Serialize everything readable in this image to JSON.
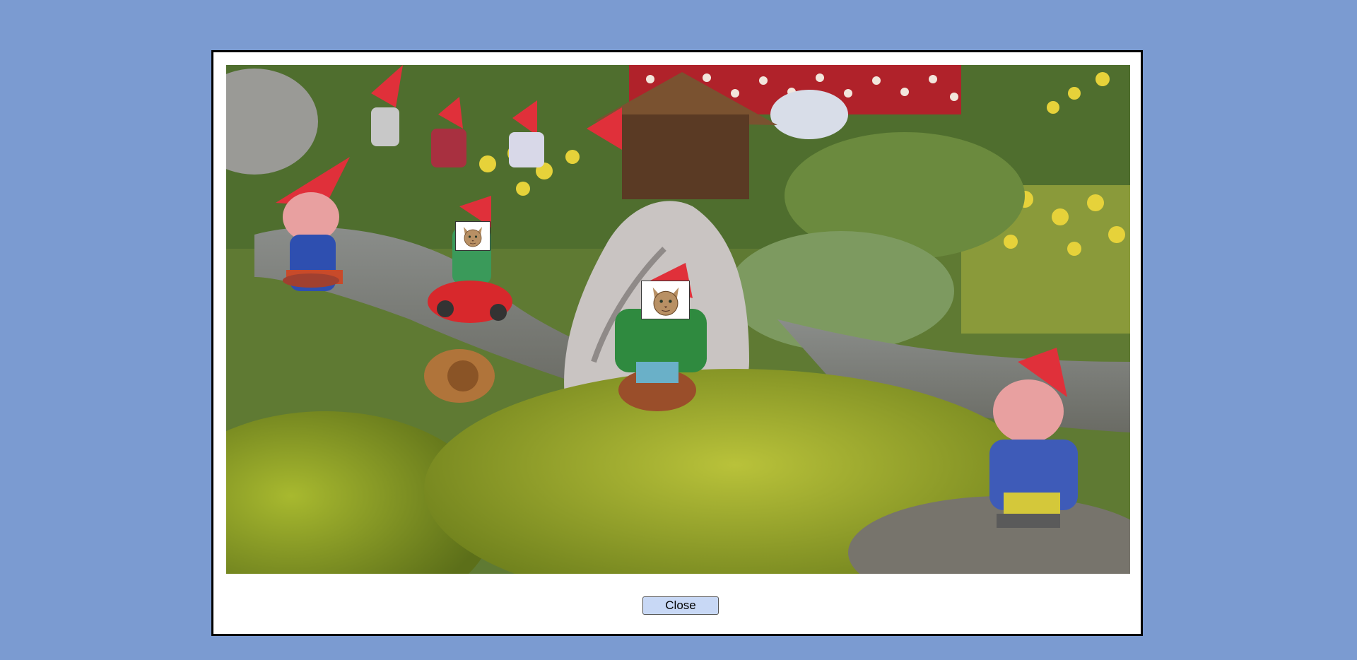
{
  "dialog": {
    "close_label": "Close"
  },
  "photo": {
    "subject": "garden-gnomes-scene",
    "face_markers": [
      {
        "icon": "cat-face-icon"
      },
      {
        "icon": "cat-face-icon"
      }
    ]
  },
  "colors": {
    "page_background": "#7b9bd1",
    "dialog_background": "#ffffff",
    "button_background": "#c8d8f5"
  }
}
